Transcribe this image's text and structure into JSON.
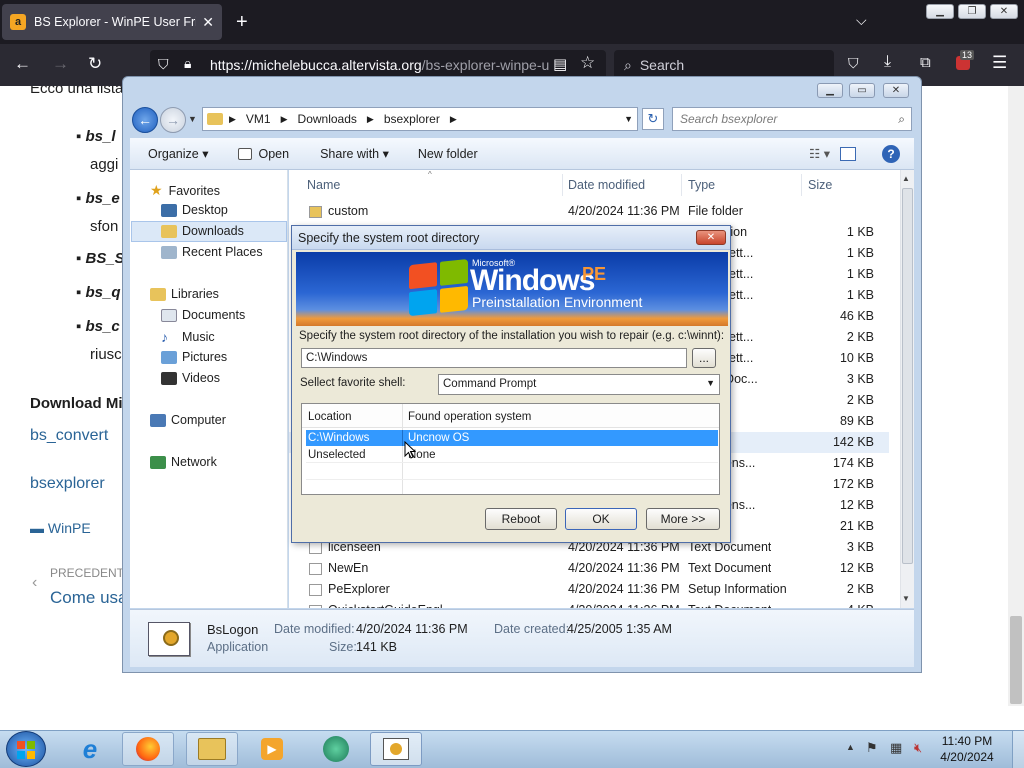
{
  "browser": {
    "tab_title": "BS Explorer - WinPE User Friend",
    "tab_favicon": "a",
    "new_tab": "+",
    "url_host": "https://michelebucca.altervista.org",
    "url_path": "/bs-explorer-winpe-u",
    "search_placeholder": "Search",
    "extensions_badge": "13"
  },
  "webpage": {
    "intro": "Ecco una lista",
    "bullets": [
      "bs_l",
      "bs_e",
      "BS_S",
      "bs_q",
      "bs_c"
    ],
    "bullet_sub": [
      "aggi",
      "sfon",
      "riusc"
    ],
    "download_heading": "Download Mi",
    "links": [
      "bs_convert",
      "bsexplorer"
    ],
    "category": "WinPE",
    "prev_label": "PRECEDENTE",
    "prev_title": "Come usa"
  },
  "explorer": {
    "breadcrumb": [
      "VM1",
      "Downloads",
      "bsexplorer"
    ],
    "search_placeholder": "Search bsexplorer",
    "toolbar": {
      "organize": "Organize",
      "open": "Open",
      "share_with": "Share with",
      "new_folder": "New folder"
    },
    "nav": {
      "favorites": "Favorites",
      "desktop": "Desktop",
      "downloads": "Downloads",
      "recent": "Recent Places",
      "libraries": "Libraries",
      "documents": "Documents",
      "music": "Music",
      "pictures": "Pictures",
      "videos": "Videos",
      "computer": "Computer",
      "network": "Network"
    },
    "columns": {
      "name": "Name",
      "date": "Date modified",
      "type": "Type",
      "size": "Size"
    },
    "files": [
      {
        "name": "custom",
        "date": "4/20/2024 11:36 PM",
        "type": "File folder",
        "size": ""
      },
      {
        "name": "",
        "date": "",
        "type": "nformation",
        "size": "1 KB"
      },
      {
        "name": "",
        "date": "",
        "type": "ration sett...",
        "size": "1 KB"
      },
      {
        "name": "",
        "date": "",
        "type": "ration sett...",
        "size": "1 KB"
      },
      {
        "name": "",
        "date": "",
        "type": "ration sett...",
        "size": "1 KB"
      },
      {
        "name": "",
        "date": "",
        "type": "mage",
        "size": "46 KB"
      },
      {
        "name": "",
        "date": "",
        "type": "ration sett...",
        "size": "2 KB"
      },
      {
        "name": "",
        "date": "",
        "type": "ration sett...",
        "size": "10 KB"
      },
      {
        "name": "",
        "date": "",
        "type": "HTML Doc...",
        "size": "3 KB"
      },
      {
        "name": "",
        "date": "",
        "type": "",
        "size": "2 KB"
      },
      {
        "name": "",
        "date": "",
        "type": "",
        "size": "89 KB"
      },
      {
        "name": "",
        "date": "",
        "type": "ion",
        "size": "142 KB"
      },
      {
        "name": "",
        "date": "",
        "type": "ion extens...",
        "size": "174 KB"
      },
      {
        "name": "",
        "date": "",
        "type": "ion",
        "size": "172 KB"
      },
      {
        "name": "",
        "date": "",
        "type": "ion extens...",
        "size": "12 KB"
      },
      {
        "name": "",
        "date": "",
        "type": "ion",
        "size": "21 KB"
      },
      {
        "name": "licenseen",
        "date": "4/20/2024 11:36 PM",
        "type": "Text Document",
        "size": "3 KB"
      },
      {
        "name": "NewEn",
        "date": "4/20/2024 11:36 PM",
        "type": "Text Document",
        "size": "12 KB"
      },
      {
        "name": "PeExplorer",
        "date": "4/20/2024 11:36 PM",
        "type": "Setup Information",
        "size": "2 KB"
      },
      {
        "name": "QuickstartGuideEngl",
        "date": "4/20/2024 11:36 PM",
        "type": "Text Document",
        "size": "4 KB"
      }
    ],
    "details": {
      "name": "BsLogon",
      "kind": "Application",
      "modified_label": "Date modified:",
      "modified": "4/20/2024 11:36 PM",
      "created_label": "Date created:",
      "created": "4/25/2005 1:35 AM",
      "size_label": "Size:",
      "size": "141 KB"
    }
  },
  "dialog": {
    "title": "Specify the system root directory",
    "close": "✕",
    "banner_microsoft": "Microsoft®",
    "banner_windows": "Windows",
    "banner_pe": "PE",
    "banner_sub": "Preinstallation Environment",
    "prompt": "Specify the system root directory of the installation you wish to repair (e.g. c:\\winnt):",
    "path_value": "C:\\Windows",
    "browse": "...",
    "shell_label": "Sellect favorite shell:",
    "shell_value": "Command Prompt",
    "table_headers": [
      "Location",
      "Found operation system"
    ],
    "table_rows": [
      {
        "location": "C:\\Windows",
        "os": "Uncnow OS"
      },
      {
        "location": "Unselected",
        "os": "None"
      }
    ],
    "buttons": {
      "reboot": "Reboot",
      "ok": "OK",
      "more": "More >>"
    }
  },
  "taskbar": {
    "time": "11:40 PM",
    "date": "4/20/2024"
  }
}
